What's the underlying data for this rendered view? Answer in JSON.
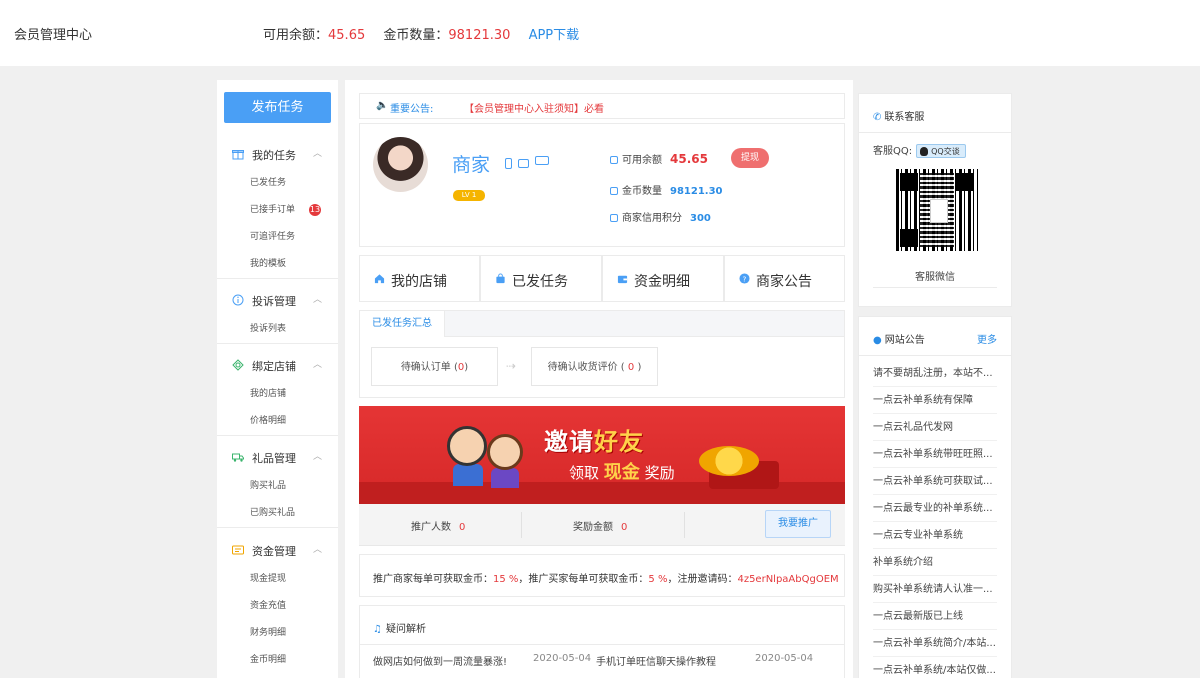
{
  "header": {
    "brand": "会员管理中心",
    "balance_label": "可用余额：",
    "balance_value": "45.65",
    "coins_label": "金币数量：",
    "coins_value": "98121.30",
    "app_download": "APP下载"
  },
  "sidebar": {
    "publish_button": "发布任务",
    "groups": [
      {
        "label": "我的任务",
        "icon": "gift-icon",
        "items": [
          "已发任务",
          "已接手订单",
          "可追评任务",
          "我的模板"
        ],
        "badge": "13"
      },
      {
        "label": "投诉管理",
        "icon": "info-icon",
        "items": [
          "投诉列表"
        ]
      },
      {
        "label": "绑定店铺",
        "icon": "shop-icon",
        "items": [
          "我的店铺",
          "价格明细"
        ]
      },
      {
        "label": "礼品管理",
        "icon": "truck-icon",
        "items": [
          "购买礼品",
          "已购买礼品"
        ]
      },
      {
        "label": "资金管理",
        "icon": "wallet-icon",
        "items": [
          "现金提现",
          "资金充值",
          "财务明细",
          "金币明细"
        ]
      }
    ]
  },
  "notice": {
    "label": "重要公告:",
    "text": "【会员管理中心入驻须知】必看"
  },
  "profile": {
    "name": "商家",
    "level": "LV 1",
    "balance_label": "可用余额",
    "balance_value": "45.65",
    "withdraw_button": "提现",
    "coins_label": "金币数量",
    "coins_value": "98121.30",
    "credit_label": "商家信用积分",
    "credit_value": "300"
  },
  "nav": [
    {
      "label": "我的店铺",
      "icon": "home-icon"
    },
    {
      "label": "已发任务",
      "icon": "bag-icon"
    },
    {
      "label": "资金明细",
      "icon": "wallet-icon"
    },
    {
      "label": "商家公告",
      "icon": "help-icon"
    }
  ],
  "tasks": {
    "tab": "已发任务汇总",
    "pending_order_label": "待确认订单",
    "pending_order_value": "0",
    "pending_review_label": "待确认收货评价",
    "pending_review_value": "0"
  },
  "banner": {
    "title_part1": "邀请",
    "title_part2": "好友",
    "sub_part1": "领取",
    "sub_part2": "现金",
    "sub_part3": "奖励"
  },
  "promo": {
    "people_label": "推广人数",
    "people_value": "0",
    "reward_label": "奖励金额",
    "reward_value": "0",
    "button": "我要推广"
  },
  "invite": {
    "text1": "推广商家每单可获取金币：",
    "merchant_rate": "15 %",
    "text2": "，推广买家每单可获取金币：",
    "buyer_rate": "5 %",
    "text3": "，注册邀请码：",
    "code": "4z5erNlpaAbQgOEM"
  },
  "faq": {
    "title": "疑问解析",
    "items": [
      {
        "q": "做网店如何做到一周流量暴涨!",
        "date": "2020-05-04"
      },
      {
        "q": "手机订单旺信聊天操作教程",
        "date": "2020-05-04"
      }
    ]
  },
  "contact": {
    "title": "联系客服",
    "qq_label": "客服QQ:",
    "qq_button": "QQ交谈",
    "wechat_label": "客服微信"
  },
  "announcements": {
    "title": "网站公告",
    "more": "更多",
    "items": [
      "请不要胡乱注册，本站不...",
      "一点云补单系统有保障",
      "一点云礼品代发网",
      "一点云补单系统带旺旺照...",
      "一点云补单系统可获取试...",
      "一点云最专业的补单系统...",
      "一点云专业补单系统",
      "补单系统介绍",
      "购买补单系统请人认准一...",
      "一点云最新版已上线",
      "一点云补单系统简介/本站...",
      "一点云补单系统/本站仅做..."
    ]
  },
  "colors": {
    "accent": "#4a9ff5",
    "red": "#e4393c",
    "banner": "#e53535"
  }
}
